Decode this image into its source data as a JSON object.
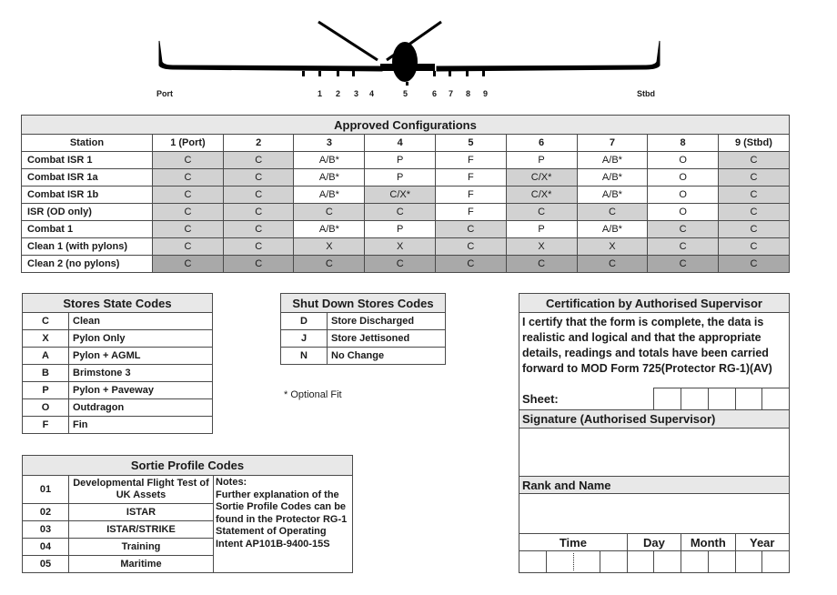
{
  "aircraft": {
    "port_label": "Port",
    "stbd_label": "Stbd",
    "station_numbers": [
      "1",
      "2",
      "3",
      "4",
      "5",
      "6",
      "7",
      "8",
      "9"
    ]
  },
  "configurations": {
    "title": "Approved Configurations",
    "headers": [
      "Station",
      "1 (Port)",
      "2",
      "3",
      "4",
      "5",
      "6",
      "7",
      "8",
      "9 (Stbd)"
    ],
    "rows": [
      {
        "name": "Combat ISR 1",
        "cells": [
          "C",
          "C",
          "A/B*",
          "P",
          "F",
          "P",
          "A/B*",
          "O",
          "C"
        ],
        "shade": [
          1,
          1,
          0,
          0,
          0,
          0,
          0,
          0,
          1
        ]
      },
      {
        "name": "Combat ISR 1a",
        "cells": [
          "C",
          "C",
          "A/B*",
          "P",
          "F",
          "C/X*",
          "A/B*",
          "O",
          "C"
        ],
        "shade": [
          1,
          1,
          0,
          0,
          0,
          1,
          0,
          0,
          1
        ]
      },
      {
        "name": "Combat ISR 1b",
        "cells": [
          "C",
          "C",
          "A/B*",
          "C/X*",
          "F",
          "C/X*",
          "A/B*",
          "O",
          "C"
        ],
        "shade": [
          1,
          1,
          0,
          1,
          0,
          1,
          0,
          0,
          1
        ]
      },
      {
        "name": "ISR (OD only)",
        "cells": [
          "C",
          "C",
          "C",
          "C",
          "F",
          "C",
          "C",
          "O",
          "C"
        ],
        "shade": [
          1,
          1,
          1,
          1,
          0,
          1,
          1,
          0,
          1
        ]
      },
      {
        "name": "Combat 1",
        "cells": [
          "C",
          "C",
          "A/B*",
          "P",
          "C",
          "P",
          "A/B*",
          "C",
          "C"
        ],
        "shade": [
          1,
          1,
          0,
          0,
          1,
          0,
          0,
          1,
          1
        ]
      },
      {
        "name": "Clean 1 (with pylons)",
        "cells": [
          "C",
          "C",
          "X",
          "X",
          "C",
          "X",
          "X",
          "C",
          "C"
        ],
        "shade": [
          1,
          1,
          1,
          1,
          1,
          1,
          1,
          1,
          1
        ]
      },
      {
        "name": "Clean 2 (no pylons)",
        "cells": [
          "C",
          "C",
          "C",
          "C",
          "C",
          "C",
          "C",
          "C",
          "C"
        ],
        "shade": [
          2,
          2,
          2,
          2,
          2,
          2,
          2,
          2,
          2
        ]
      }
    ]
  },
  "stores_state": {
    "title": "Stores State Codes",
    "items": [
      {
        "code": "C",
        "desc": "Clean"
      },
      {
        "code": "X",
        "desc": "Pylon Only"
      },
      {
        "code": "A",
        "desc": "Pylon + AGML"
      },
      {
        "code": "B",
        "desc": "Brimstone 3"
      },
      {
        "code": "P",
        "desc": "Pylon  + Paveway"
      },
      {
        "code": "O",
        "desc": "Outdragon"
      },
      {
        "code": "F",
        "desc": "Fin"
      }
    ]
  },
  "shutdown": {
    "title": "Shut Down Stores Codes",
    "items": [
      {
        "code": "D",
        "desc": "Store Discharged"
      },
      {
        "code": "J",
        "desc": "Store Jettisoned"
      },
      {
        "code": "N",
        "desc": "No Change"
      }
    ],
    "footnote": "* Optional Fit"
  },
  "sortie": {
    "title": "Sortie Profile Codes",
    "items": [
      {
        "code": "01",
        "desc": "Developmental Flight Test of UK Assets"
      },
      {
        "code": "02",
        "desc": "ISTAR"
      },
      {
        "code": "03",
        "desc": "ISTAR/STRIKE"
      },
      {
        "code": "04",
        "desc": "Training"
      },
      {
        "code": "05",
        "desc": "Maritime"
      }
    ],
    "notes_title": "Notes:",
    "notes_text": "Further explanation of the Sortie Profile Codes can be found in the Protector RG-1 Statement of Operating Intent AP101B-9400-15S"
  },
  "certification": {
    "title": "Certification by Authorised Supervisor",
    "statement": "I certify that the form is complete, the data is realistic and logical and that the appropriate details, readings and totals have been carried forward to MOD Form 725(Protector RG-1)(AV)",
    "sheet_label": "Sheet:",
    "signature_label": "Signature (Authorised Supervisor)",
    "rank_label": "Rank and Name",
    "time_label": "Time",
    "day_label": "Day",
    "month_label": "Month",
    "year_label": "Year"
  }
}
